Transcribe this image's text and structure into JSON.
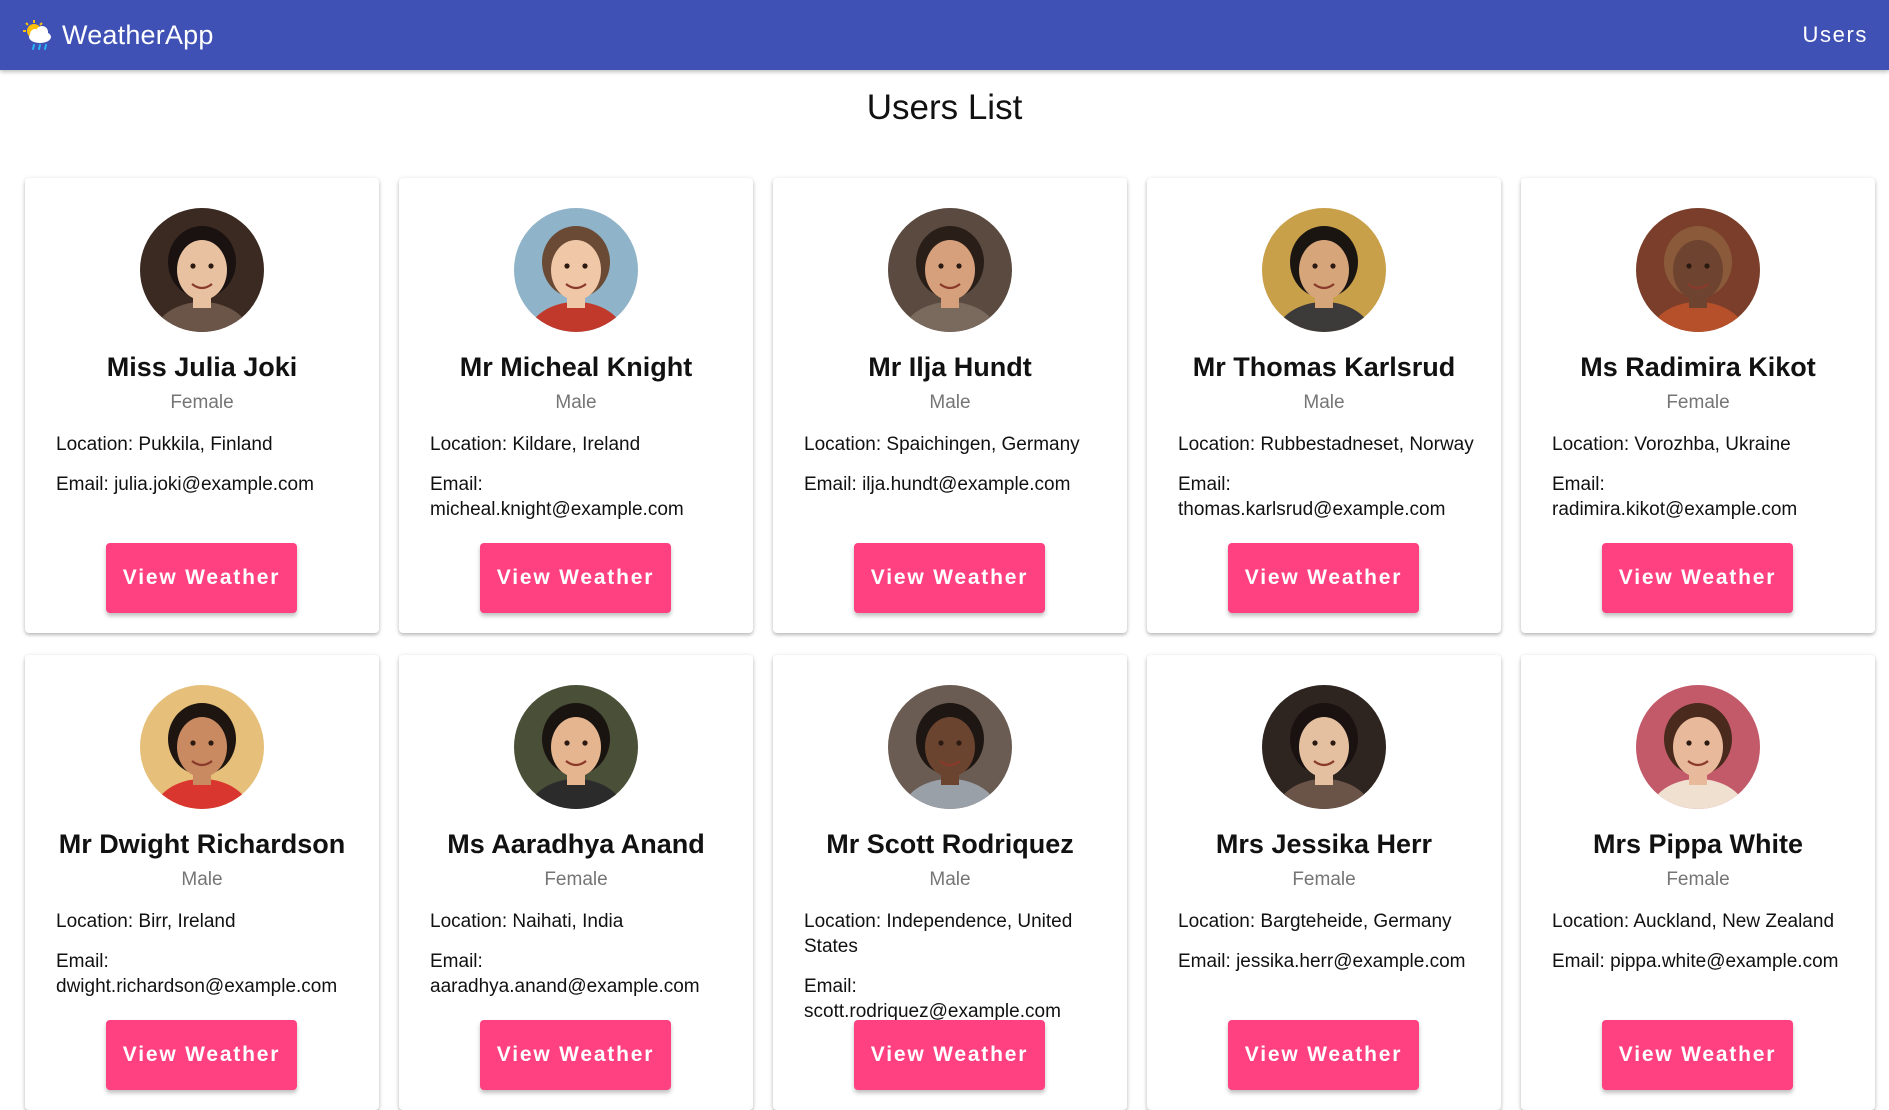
{
  "app": {
    "name": "WeatherApp",
    "logo_icon": "weather-cloud-sun-rain-icon",
    "nav_users": "Users",
    "accent": "#3f51b5",
    "button_color": "#ff4081"
  },
  "page": {
    "title": "Users List"
  },
  "users": [
    {
      "name": "Miss Julia Joki",
      "gender": "Female",
      "location": "Location: Pukkila, Finland",
      "email": "Email: julia.joki@example.com",
      "button": "View Weather"
    },
    {
      "name": "Mr Micheal Knight",
      "gender": "Male",
      "location": "Location: Kildare, Ireland",
      "email": "Email: micheal.knight@example.com",
      "button": "View Weather"
    },
    {
      "name": "Mr Ilja Hundt",
      "gender": "Male",
      "location": "Location: Spaichingen, Germany",
      "email": "Email: ilja.hundt@example.com",
      "button": "View Weather"
    },
    {
      "name": "Mr Thomas Karlsrud",
      "gender": "Male",
      "location": "Location: Rubbestadneset, Norway",
      "email": "Email: thomas.karlsrud@example.com",
      "button": "View Weather"
    },
    {
      "name": "Ms Radimira Kikot",
      "gender": "Female",
      "location": "Location: Vorozhba, Ukraine",
      "email": "Email: radimira.kikot@example.com",
      "button": "View Weather"
    },
    {
      "name": "Mr Dwight Richardson",
      "gender": "Male",
      "location": "Location: Birr, Ireland",
      "email": "Email: dwight.richardson@example.com",
      "button": "View Weather"
    },
    {
      "name": "Ms Aaradhya Anand",
      "gender": "Female",
      "location": "Location: Naihati, India",
      "email": "Email: aaradhya.anand@example.com",
      "button": "View Weather"
    },
    {
      "name": "Mr Scott Rodriquez",
      "gender": "Male",
      "location": "Location: Independence, United States",
      "email": "Email: scott.rodriquez@example.com",
      "button": "View Weather"
    },
    {
      "name": "Mrs Jessika Herr",
      "gender": "Female",
      "location": "Location: Bargteheide, Germany",
      "email": "Email: jessika.herr@example.com",
      "button": "View Weather"
    },
    {
      "name": "Mrs Pippa White",
      "gender": "Female",
      "location": "Location: Auckland, New Zealand",
      "email": "Email: pippa.white@example.com",
      "button": "View Weather"
    }
  ]
}
